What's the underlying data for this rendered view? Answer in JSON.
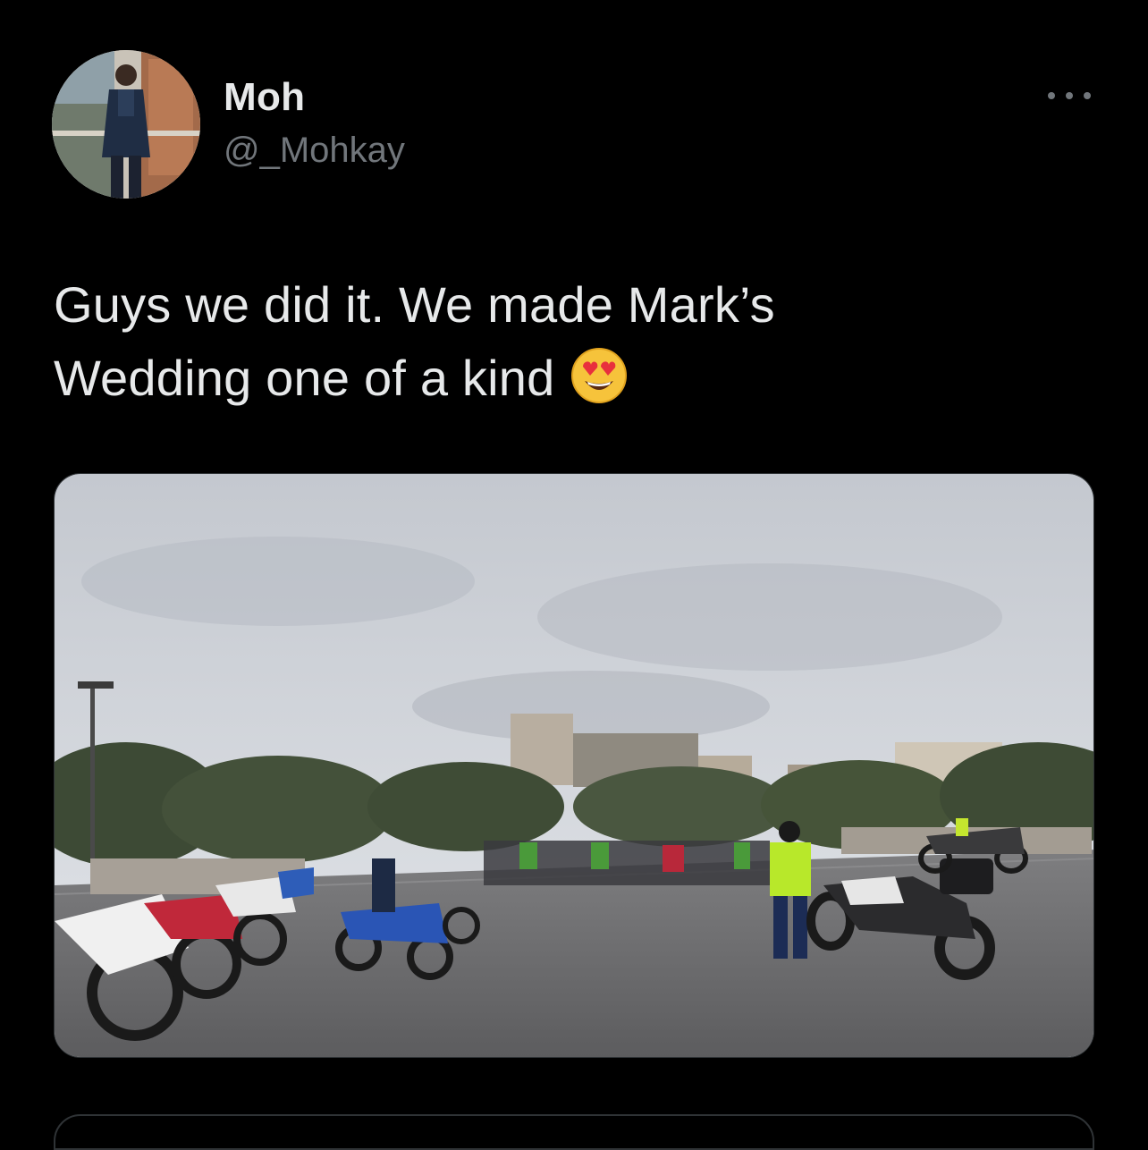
{
  "tweet": {
    "author": {
      "display_name": "Moh",
      "handle": "@_Mohkay",
      "avatar_icon": "profile-photo"
    },
    "more_icon": "more-horizontal-icon",
    "text_line_1": "Guys we did it. We made Mark’s",
    "text_line_2": "Wedding one of a kind",
    "emoji": "smiling-face-with-heart-eyes",
    "media": {
      "type": "photo",
      "icon": "photo-motorcycles"
    }
  },
  "colors": {
    "background": "#000000",
    "primary_text": "#e7e9ea",
    "secondary_text": "#71767b",
    "border": "#2f3336"
  }
}
